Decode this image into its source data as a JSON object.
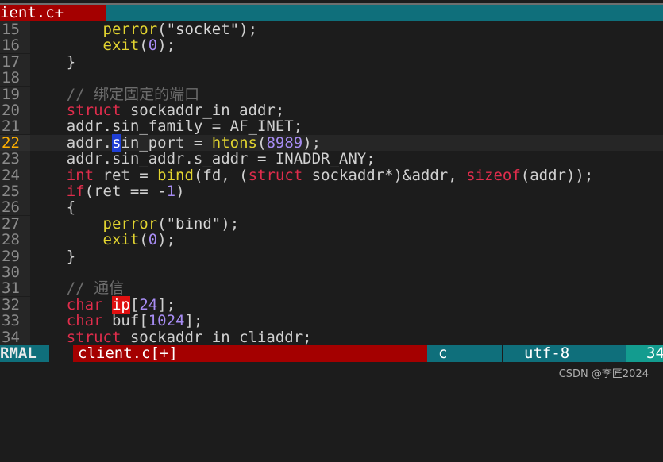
{
  "tabline": {
    "active_tab": "ient.c+"
  },
  "lines": [
    {
      "n": "15",
      "tokens": [
        [
          "",
          "        "
        ],
        [
          "fn",
          "perror"
        ],
        [
          "",
          "("
        ],
        [
          "str",
          "\"socket\""
        ],
        [
          "",
          ");"
        ]
      ]
    },
    {
      "n": "16",
      "tokens": [
        [
          "",
          "        "
        ],
        [
          "fn",
          "exit"
        ],
        [
          "",
          "("
        ],
        [
          "num",
          "0"
        ],
        [
          "",
          ");"
        ]
      ]
    },
    {
      "n": "17",
      "tokens": [
        [
          "",
          "    }"
        ]
      ]
    },
    {
      "n": "18",
      "tokens": []
    },
    {
      "n": "19",
      "tokens": [
        [
          "",
          "    "
        ],
        [
          "cm",
          "// 绑定固定的端口"
        ]
      ]
    },
    {
      "n": "20",
      "tokens": [
        [
          "",
          "    "
        ],
        [
          "ty",
          "struct"
        ],
        [
          "",
          " sockaddr_in addr;"
        ]
      ]
    },
    {
      "n": "21",
      "tokens": [
        [
          "",
          "    addr.sin_family = AF_INET;"
        ]
      ]
    },
    {
      "n": "22",
      "current": true,
      "tokens": [
        [
          "",
          "    addr."
        ],
        [
          "cur",
          "s"
        ],
        [
          "",
          "in_port = "
        ],
        [
          "fn",
          "htons"
        ],
        [
          "",
          "("
        ],
        [
          "num",
          "8989"
        ],
        [
          "",
          ");"
        ]
      ]
    },
    {
      "n": "23",
      "tokens": [
        [
          "",
          "    addr.sin_addr.s_addr = INADDR_ANY;"
        ]
      ]
    },
    {
      "n": "24",
      "tokens": [
        [
          "",
          "    "
        ],
        [
          "ty",
          "int"
        ],
        [
          "",
          " ret = "
        ],
        [
          "fn",
          "bind"
        ],
        [
          "",
          "(fd, ("
        ],
        [
          "ty",
          "struct"
        ],
        [
          "",
          " sockaddr*)&addr, "
        ],
        [
          "kw",
          "sizeof"
        ],
        [
          "",
          "(addr));"
        ]
      ]
    },
    {
      "n": "25",
      "tokens": [
        [
          "",
          "    "
        ],
        [
          "kw",
          "if"
        ],
        [
          "",
          "(ret == -"
        ],
        [
          "num",
          "1"
        ],
        [
          "",
          ")"
        ]
      ]
    },
    {
      "n": "26",
      "tokens": [
        [
          "",
          "    {"
        ]
      ]
    },
    {
      "n": "27",
      "tokens": [
        [
          "",
          "        "
        ],
        [
          "fn",
          "perror"
        ],
        [
          "",
          "("
        ],
        [
          "str",
          "\"bind\""
        ],
        [
          "",
          ");"
        ]
      ]
    },
    {
      "n": "28",
      "tokens": [
        [
          "",
          "        "
        ],
        [
          "fn",
          "exit"
        ],
        [
          "",
          "("
        ],
        [
          "num",
          "0"
        ],
        [
          "",
          ");"
        ]
      ]
    },
    {
      "n": "29",
      "tokens": [
        [
          "",
          "    }"
        ]
      ]
    },
    {
      "n": "30",
      "tokens": []
    },
    {
      "n": "31",
      "tokens": [
        [
          "",
          "    "
        ],
        [
          "cm",
          "// 通信"
        ]
      ]
    },
    {
      "n": "32",
      "tokens": [
        [
          "",
          "    "
        ],
        [
          "ty",
          "char"
        ],
        [
          "",
          " "
        ],
        [
          "hl",
          "ip"
        ],
        [
          "",
          "["
        ],
        [
          "num",
          "24"
        ],
        [
          "",
          "];"
        ]
      ]
    },
    {
      "n": "33",
      "tokens": [
        [
          "",
          "    "
        ],
        [
          "ty",
          "char"
        ],
        [
          "",
          " buf["
        ],
        [
          "num",
          "1024"
        ],
        [
          "",
          "];"
        ]
      ]
    },
    {
      "n": "34",
      "tokens": [
        [
          "",
          "    "
        ],
        [
          "ty",
          "struct"
        ],
        [
          "",
          " sockaddr_in cliaddr;"
        ]
      ]
    }
  ],
  "statusline": {
    "mode": "RMAL",
    "gap": "",
    "filename": "client.c[+]",
    "filetype": "c",
    "encoding": "utf-8",
    "position": "34"
  },
  "watermark": "CSDN @李匠2024",
  "colors": {
    "background": "#1c1c1c",
    "tab_active": "#a40000",
    "teal": "#0f6f7b",
    "keyword": "#e02d4c",
    "function": "#e2d430",
    "number": "#a78cf3",
    "comment": "#6c6c6c"
  }
}
